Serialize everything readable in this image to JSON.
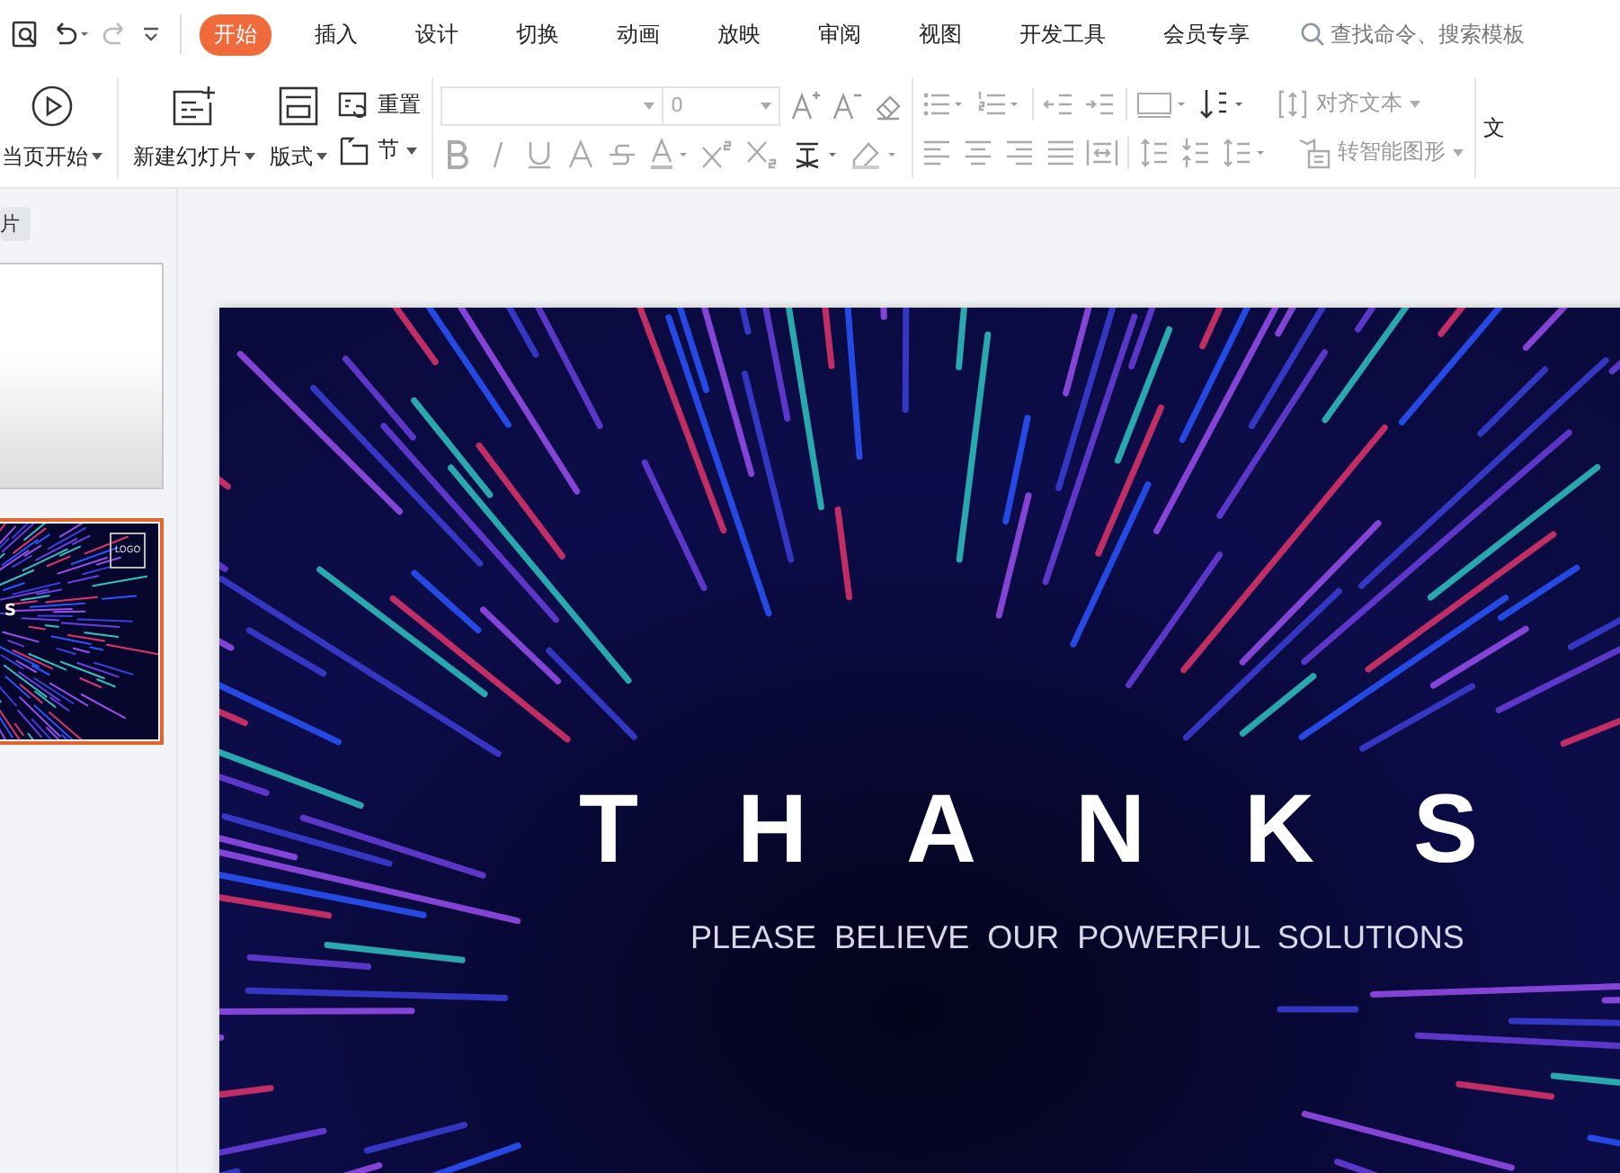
{
  "tabs": [
    {
      "label": "开始",
      "selected": true
    },
    {
      "label": "插入",
      "selected": false
    },
    {
      "label": "设计",
      "selected": false
    },
    {
      "label": "切换",
      "selected": false
    },
    {
      "label": "动画",
      "selected": false
    },
    {
      "label": "放映",
      "selected": false
    },
    {
      "label": "审阅",
      "selected": false
    },
    {
      "label": "视图",
      "selected": false
    },
    {
      "label": "开发工具",
      "selected": false
    },
    {
      "label": "会员专享",
      "selected": false
    }
  ],
  "search": {
    "placeholder": "查找命令、搜索模板"
  },
  "ribbon": {
    "play_from_current": "当页开始",
    "new_slide": "新建幻灯片",
    "layout": "版式",
    "reset": "重置",
    "section": "节",
    "font_size": "0",
    "align_text": "对齐文本",
    "smart_graphic": "转智能图形",
    "cut_label": "文"
  },
  "slides_panel": {
    "tab": "片",
    "thumbnails": [
      {
        "kind": "blank",
        "selected": false
      },
      {
        "kind": "picture",
        "selected": true,
        "title": "S",
        "logo": "LOGO"
      }
    ]
  },
  "slide": {
    "kind": "picture",
    "title": "THANKS",
    "subtitle": "PLEASE BELIEVE OUR POWERFUL SOLUTIONS"
  }
}
